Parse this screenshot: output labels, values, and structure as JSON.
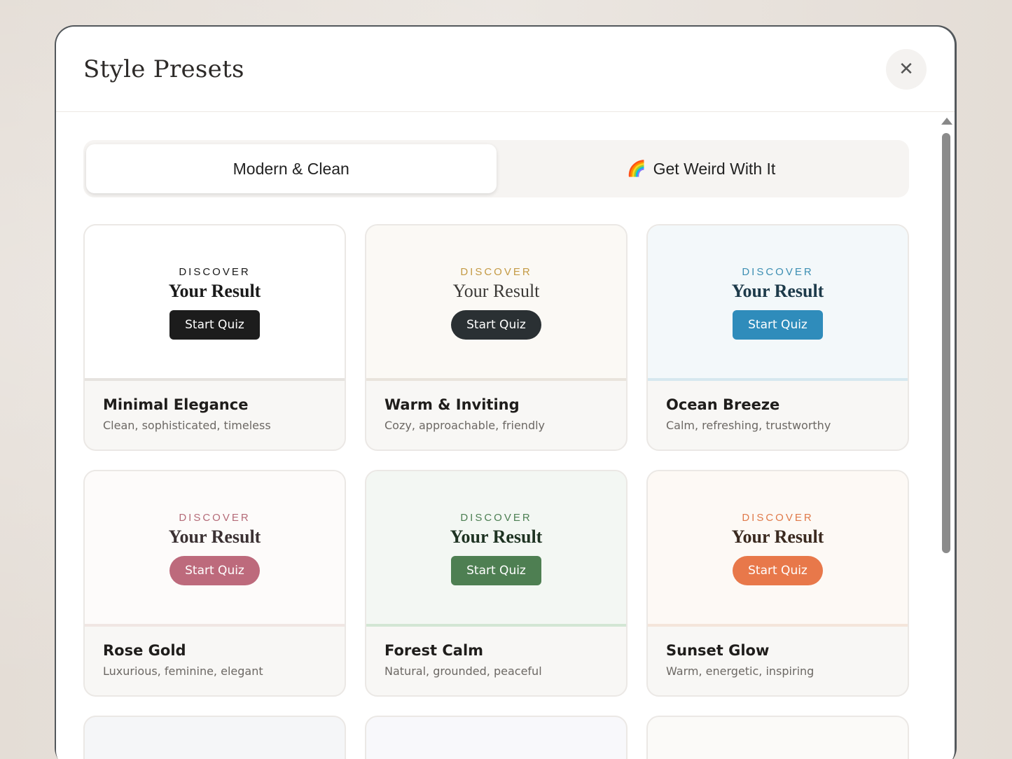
{
  "modal": {
    "title": "Style Presets",
    "close_label": "✕"
  },
  "tabs": [
    {
      "label": "Modern & Clean",
      "active": true
    },
    {
      "label": "Get Weird With It",
      "emoji": "🌈",
      "active": false
    }
  ],
  "presets": [
    {
      "name": "Minimal Elegance",
      "desc": "Clean, sophisticated, timeless",
      "discover": "DISCOVER",
      "headline": "Your Result",
      "button": "Start Quiz",
      "colors": {
        "preview_bg": "#ffffff",
        "accent_text": "#1a1a1a",
        "headline": "#1a1a1a",
        "button_bg": "#1c1c1c",
        "divider": "#e6e3df"
      },
      "button_shape": "rounded",
      "headline_weight": "bold"
    },
    {
      "name": "Warm & Inviting",
      "desc": "Cozy, approachable, friendly",
      "discover": "DISCOVER",
      "headline": "Your Result",
      "button": "Start Quiz",
      "colors": {
        "preview_bg": "#fbf9f5",
        "accent_text": "#c49a44",
        "headline": "#3c3a37",
        "button_bg": "#2a3033",
        "divider": "#e9e4dc"
      },
      "button_shape": "pill",
      "headline_weight": "light"
    },
    {
      "name": "Ocean Breeze",
      "desc": "Calm, refreshing, trustworthy",
      "discover": "DISCOVER",
      "headline": "Your Result",
      "button": "Start Quiz",
      "colors": {
        "preview_bg": "#f3f8fa",
        "accent_text": "#3d8fb3",
        "headline": "#1d3a4a",
        "button_bg": "#2f8cbb",
        "divider": "#d6e8ef"
      },
      "button_shape": "rounded",
      "headline_weight": "bold"
    },
    {
      "name": "Rose Gold",
      "desc": "Luxurious, feminine, elegant",
      "discover": "DISCOVER",
      "headline": "Your Result",
      "button": "Start Quiz",
      "colors": {
        "preview_bg": "#fdfbfa",
        "accent_text": "#b56b78",
        "headline": "#3b3133",
        "button_bg": "#bd6a7c",
        "divider": "#f0e6e3"
      },
      "button_shape": "pill",
      "headline_weight": "bold"
    },
    {
      "name": "Forest Calm",
      "desc": "Natural, grounded, peaceful",
      "discover": "DISCOVER",
      "headline": "Your Result",
      "button": "Start Quiz",
      "colors": {
        "preview_bg": "#f3f7f3",
        "accent_text": "#4c7f52",
        "headline": "#1e3322",
        "button_bg": "#4e7f52",
        "divider": "#d3e6d4"
      },
      "button_shape": "rounded",
      "headline_weight": "bold"
    },
    {
      "name": "Sunset Glow",
      "desc": "Warm, energetic, inspiring",
      "discover": "DISCOVER",
      "headline": "Your Result",
      "button": "Start Quiz",
      "colors": {
        "preview_bg": "#fdf9f5",
        "accent_text": "#e07a4a",
        "headline": "#3b2a20",
        "button_bg": "#e8784a",
        "divider": "#f4e5da"
      },
      "button_shape": "pill",
      "headline_weight": "bold"
    }
  ],
  "partial_cards": [
    {
      "preview_bg": "#f5f6f8"
    },
    {
      "preview_bg": "#f8f8fb"
    },
    {
      "preview_bg": "#fbfaf8"
    }
  ]
}
